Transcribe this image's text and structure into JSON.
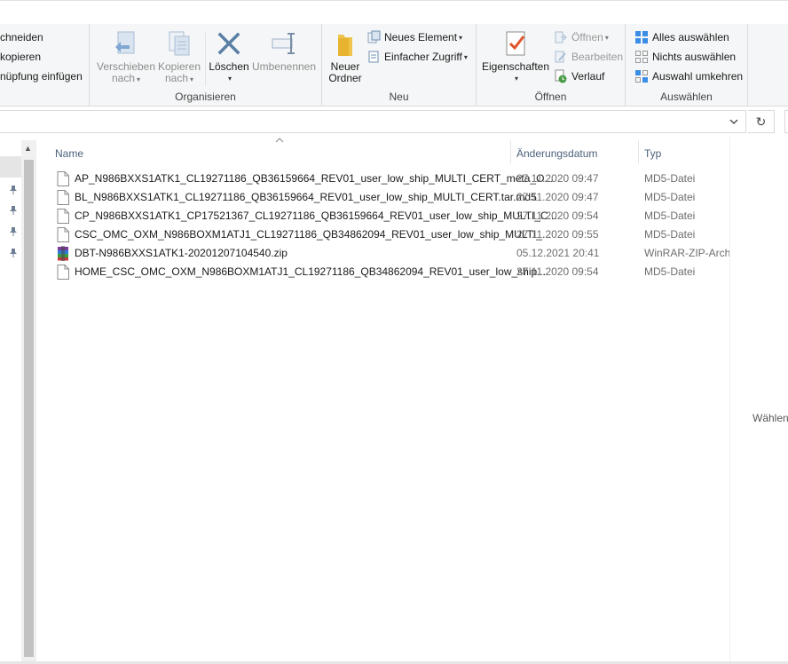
{
  "ribbon": {
    "clipboard": {
      "cut_label": "chneiden",
      "copy_path_label": "kopieren",
      "paste_shortcut_label": "nüpfung einfügen"
    },
    "organize": {
      "label": "Organisieren",
      "move_to_label_1": "Verschieben",
      "move_to_label_2": "nach",
      "copy_to_label_1": "Kopieren",
      "copy_to_label_2": "nach",
      "delete_label": "Löschen",
      "rename_label": "Umbenennen"
    },
    "new": {
      "label": "Neu",
      "new_folder_label_1": "Neuer",
      "new_folder_label_2": "Ordner",
      "new_item_label": "Neues Element",
      "easy_access_label": "Einfacher Zugriff"
    },
    "open": {
      "label": "Öffnen",
      "properties_label": "Eigenschaften",
      "open_label": "Öffnen",
      "edit_label": "Bearbeiten",
      "history_label": "Verlauf"
    },
    "select": {
      "label": "Auswählen",
      "select_all_label": "Alles auswählen",
      "select_none_label": "Nichts auswählen",
      "invert_selection_label": "Auswahl umkehren"
    }
  },
  "address_bar": {
    "dropdown_icon": "chevron-down-icon",
    "refresh_icon": "refresh-icon",
    "refresh_glyph": "↻"
  },
  "file_list": {
    "columns": {
      "name": "Name",
      "date": "Änderungsdatum",
      "type": "Typ"
    },
    "files": [
      {
        "name": "AP_N986BXXS1ATK1_CL19271186_QB36159664_REV01_user_low_ship_MULTI_CERT_meta_O...",
        "date": "27.11.2020 09:47",
        "type": "MD5-Datei",
        "icon": "md5-file-icon"
      },
      {
        "name": "BL_N986BXXS1ATK1_CL19271186_QB36159664_REV01_user_low_ship_MULTI_CERT.tar.md5",
        "date": "27.11.2020 09:47",
        "type": "MD5-Datei",
        "icon": "md5-file-icon"
      },
      {
        "name": "CP_N986BXXS1ATK1_CP17521367_CL19271186_QB36159664_REV01_user_low_ship_MULTI_C...",
        "date": "27.11.2020 09:54",
        "type": "MD5-Datei",
        "icon": "md5-file-icon"
      },
      {
        "name": "CSC_OMC_OXM_N986BOXM1ATJ1_CL19271186_QB34862094_REV01_user_low_ship_MULTI_...",
        "date": "27.11.2020 09:55",
        "type": "MD5-Datei",
        "icon": "md5-file-icon"
      },
      {
        "name": "DBT-N986BXXS1ATK1-20201207104540.zip",
        "date": "05.12.2021 20:41",
        "type": "WinRAR-ZIP-Arch",
        "icon": "winrar-zip-icon"
      },
      {
        "name": "HOME_CSC_OMC_OXM_N986BOXM1ATJ1_CL19271186_QB34862094_REV01_user_low_ship...",
        "date": "27.11.2020 09:54",
        "type": "MD5-Datei",
        "icon": "md5-file-icon"
      }
    ]
  },
  "preview_pane": {
    "text": "Wählen"
  },
  "colors": {
    "accent": "#1e6fd9",
    "header_text": "#4c607a",
    "meta_text": "#6d6d6d"
  }
}
